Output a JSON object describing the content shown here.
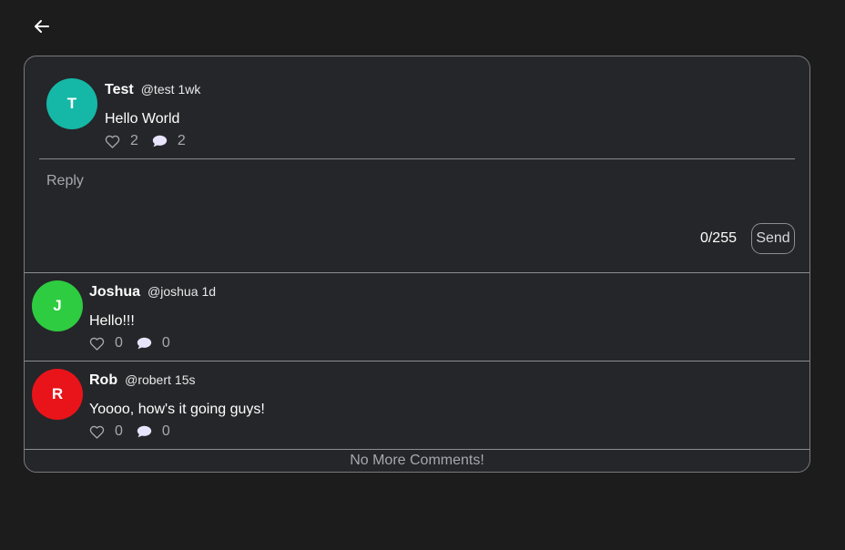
{
  "post": {
    "avatar_letter": "T",
    "avatar_color": "#15b8a6",
    "name": "Test",
    "handle": "@test",
    "time": "1wk",
    "text": "Hello World",
    "likes": "2",
    "comments": "2"
  },
  "reply": {
    "placeholder": "Reply",
    "char_count": "0/255",
    "send_label": "Send"
  },
  "comments": [
    {
      "avatar_letter": "J",
      "avatar_color": "#2ecc40",
      "name": "Joshua",
      "handle": "@joshua",
      "time": "1d",
      "text": "Hello!!!",
      "likes": "0",
      "comments": "0"
    },
    {
      "avatar_letter": "R",
      "avatar_color": "#e8141a",
      "name": "Rob",
      "handle": "@robert",
      "time": "15s",
      "text": "Yoooo, how's it going guys!",
      "likes": "0",
      "comments": "0"
    }
  ],
  "footer_text": "No More Comments!",
  "icons": {
    "back": "arrow-left-icon",
    "like": "heart-icon",
    "comment": "speech-bubble-icon"
  }
}
